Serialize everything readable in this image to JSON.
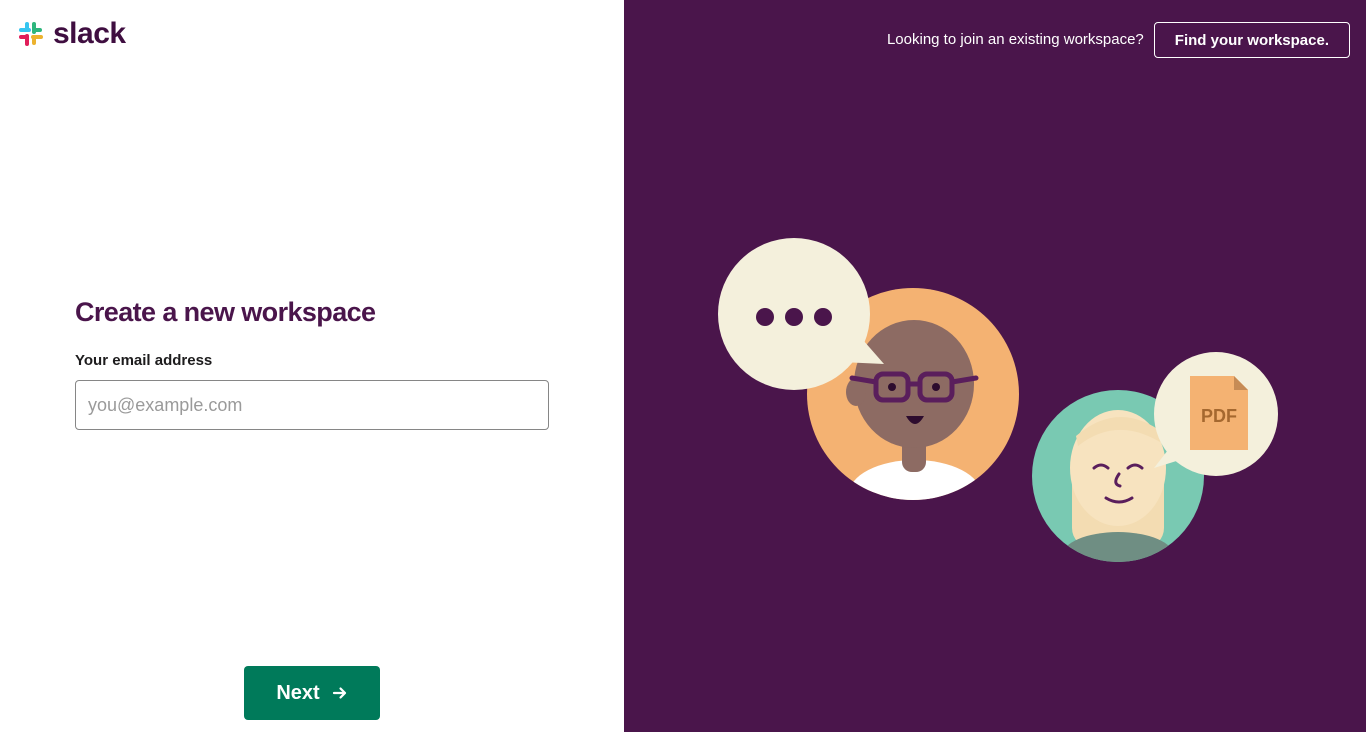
{
  "brand": {
    "name": "slack",
    "colors": {
      "aubergine": "#4a154b",
      "green": "#007a5a",
      "white": "#ffffff"
    }
  },
  "header": {
    "prompt": "Looking to join an existing workspace?",
    "find_button_label": "Find your workspace."
  },
  "form": {
    "title": "Create a new workspace",
    "email_label": "Your email address",
    "email_placeholder": "you@example.com",
    "email_value": ""
  },
  "actions": {
    "next_label": "Next",
    "next_icon": "arrow-right-icon"
  },
  "illustration": {
    "file_badge": "PDF",
    "icons": [
      "chat-bubble-icon",
      "avatar-icon",
      "pdf-file-icon"
    ]
  }
}
